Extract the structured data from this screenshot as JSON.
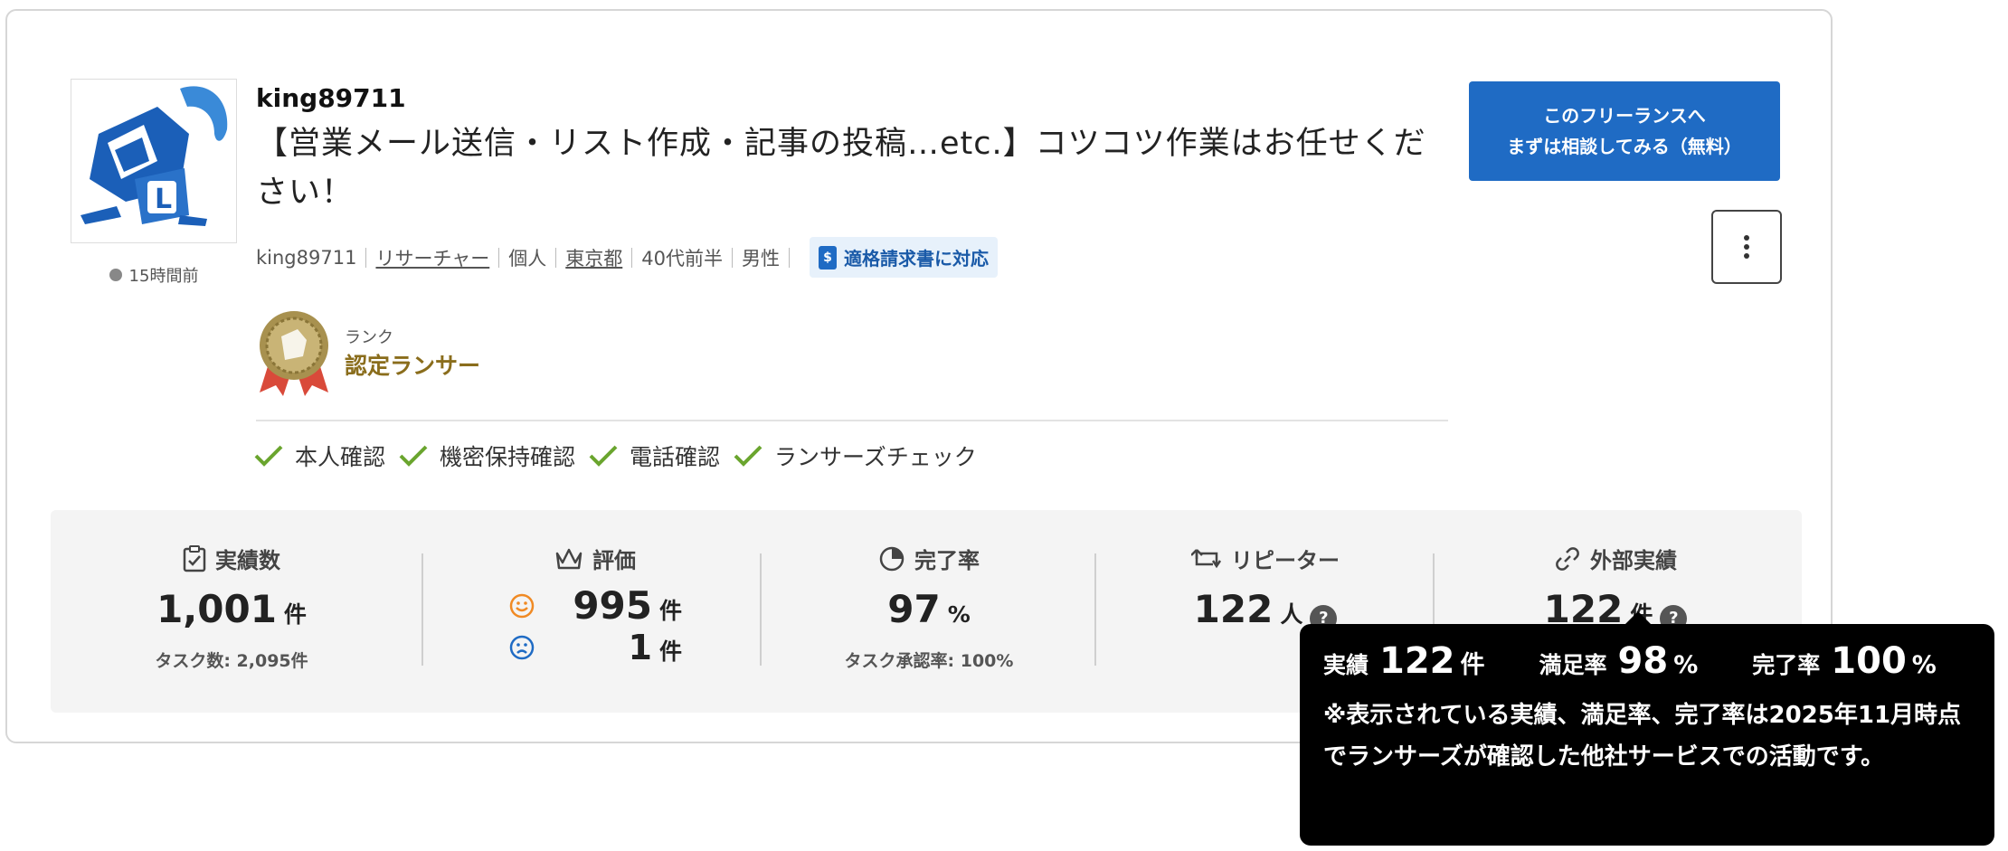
{
  "profile": {
    "username": "king89711",
    "last_active": "15時間前",
    "title": "【営業メール送信・リスト作成・記事の投稿…etc.】コツコツ作業はお任せください！",
    "meta": {
      "id": "king89711",
      "job": "リサーチャー",
      "type": "個人",
      "location": "東京都",
      "age": "40代前半",
      "gender": "男性"
    },
    "invoice_badge": "適格請求書に対応",
    "rank_label": "ランク",
    "rank_value": "認定ランサー",
    "checks": [
      "本人確認",
      "機密保持確認",
      "電話確認",
      "ランサーズチェック"
    ]
  },
  "cta": {
    "line1": "このフリーランスへ",
    "line2": "まずは相談してみる（無料）"
  },
  "stats": {
    "achievements": {
      "label": "実績数",
      "value": "1,001",
      "unit": "件",
      "sub": "タスク数: 2,095件"
    },
    "rating": {
      "label": "評価",
      "good": "995",
      "bad": "1",
      "unit": "件"
    },
    "completion": {
      "label": "完了率",
      "value": "97",
      "unit": "%",
      "sub": "タスク承認率: 100%"
    },
    "repeater": {
      "label": "リピーター",
      "value": "122",
      "unit": "人"
    },
    "external": {
      "label": "外部実績",
      "value": "122",
      "unit": "件"
    }
  },
  "tooltip": {
    "items": [
      {
        "label": "実績",
        "value": "122",
        "unit": "件"
      },
      {
        "label": "満足率",
        "value": "98",
        "unit": "%"
      },
      {
        "label": "完了率",
        "value": "100",
        "unit": "%"
      }
    ],
    "note": "※表示されている実績、満足率、完了率は2025年11月時点でランサーズが確認した他社サービスでの活動です。",
    "qmark": "?"
  },
  "colors": {
    "primary": "#1f6bc4",
    "check": "#6aa52e",
    "rank_gold": "#8a6d1c",
    "good_face": "#f08a24",
    "bad_face": "#1f6bc4"
  }
}
